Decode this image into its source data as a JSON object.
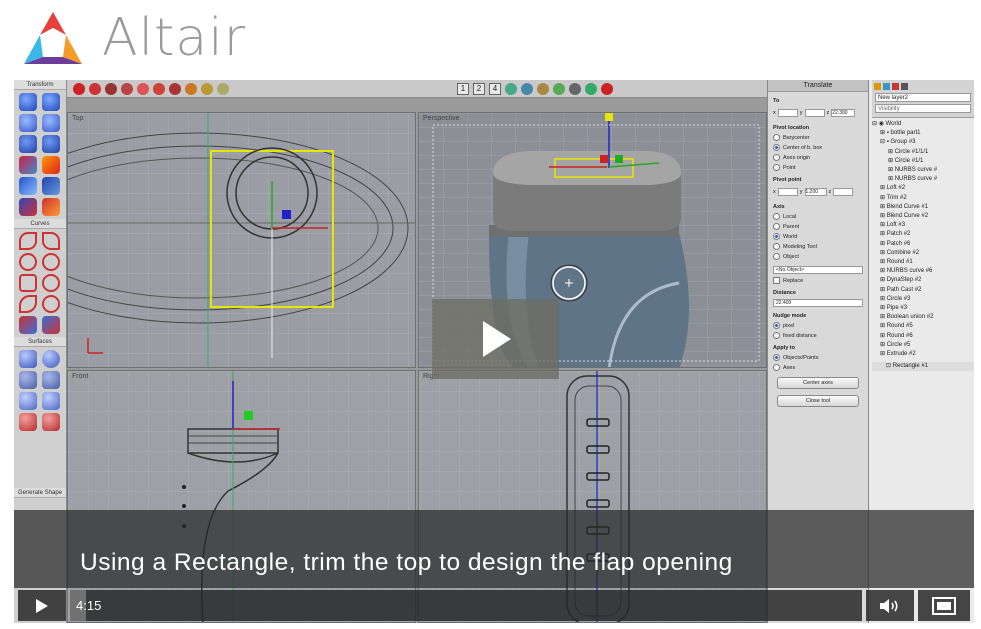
{
  "brand": {
    "name": "Altair",
    "logo_icon": "altair-triangle-logo"
  },
  "video": {
    "caption": "Using a Rectangle, trim the top to design the flap opening",
    "time": "4:15",
    "progress": 0.02,
    "controls": {
      "play_icon": "play-icon",
      "volume_icon": "volume-icon",
      "fullscreen_icon": "fullscreen-icon",
      "big_play_icon": "play-icon"
    }
  },
  "app": {
    "left_toolbar": {
      "sections": [
        "Transform",
        "Curves",
        "Surfaces",
        "Generate Shape"
      ]
    },
    "top_toolbar": {
      "view_numbers": [
        "1",
        "2",
        "4"
      ]
    },
    "viewports": {
      "top": "Top",
      "perspective": "Perspective",
      "front": "Front",
      "right": "Right"
    },
    "translate_panel": {
      "title": "Translate",
      "to_label": "To",
      "to_x": "x",
      "to_y": "y",
      "to_z": "z",
      "to_z_value": "22.300",
      "pivot_location_label": "Pivot location",
      "pivot_options": [
        "Barycenter",
        "Center of b. box",
        "Axes origin",
        "Point"
      ],
      "pivot_selected": 1,
      "pivot_point_label": "Pivot point",
      "pivot_point_y": "1.200",
      "axis_label": "Axis",
      "axis_options": [
        "Local",
        "Parent",
        "World",
        "Modeling Tool",
        "Object"
      ],
      "axis_selected": 2,
      "no_object": "<No Object>",
      "replace_label": "Replace",
      "distance_label": "Distance",
      "distance_value": "22.400",
      "nudge_label": "Nudge mode",
      "nudge_options": [
        "pixel",
        "fixed distance"
      ],
      "nudge_selected": 0,
      "apply_label": "Apply to",
      "apply_options": [
        "Objects/Points",
        "Axes"
      ],
      "apply_selected": 0,
      "center_axes_button": "Center axes",
      "close_tool_button": "Close tool"
    },
    "tree_panel": {
      "layer": "New layer2",
      "visibility": "Visibility",
      "items": [
        "World",
        "bottle part1",
        "Group #3",
        "Circle #1/1/1",
        "Circle #1/1",
        "NURBS curve #",
        "NURBS curve #",
        "Loft #2",
        "Trim #2",
        "Blend Curve #1",
        "Blend Curve #2",
        "Loft #3",
        "Patch #2",
        "Patch #6",
        "Combine #2",
        "Round #1",
        "NURBS curve #6",
        "DynaStep #2",
        "Path Cast #2",
        "Circle #3",
        "Pipe #3",
        "Boolean union #2",
        "Round #5",
        "Round #6",
        "Circle #5",
        "Extrude #2",
        "Rectangle #1"
      ]
    }
  }
}
